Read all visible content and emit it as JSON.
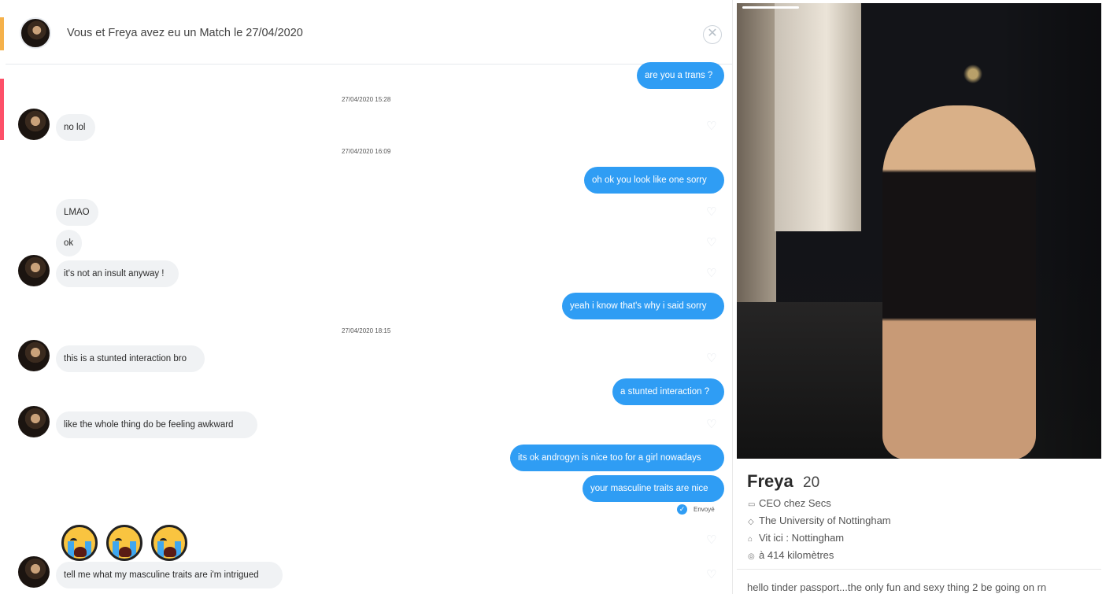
{
  "header": {
    "title": "Vous et Freya avez eu un Match le 27/04/2020"
  },
  "messages": [
    {
      "dir": "out",
      "text": "are you a trans ?"
    },
    {
      "ts": "27/04/2020 15:28"
    },
    {
      "dir": "in",
      "text": "no lol"
    },
    {
      "ts": "27/04/2020 16:09"
    },
    {
      "dir": "out",
      "text": "oh ok you look like one sorry"
    },
    {
      "dir": "in",
      "text": "LMAO"
    },
    {
      "dir": "in",
      "text": "ok"
    },
    {
      "dir": "in",
      "text": "it's not an insult anyway !"
    },
    {
      "dir": "out",
      "text": "yeah i know that's why i said sorry"
    },
    {
      "ts": "27/04/2020 18:15"
    },
    {
      "dir": "in",
      "text": "this is a stunted interaction bro"
    },
    {
      "dir": "out",
      "text": "a stunted interaction ?"
    },
    {
      "dir": "in",
      "text": "like the whole thing do be feeling awkward"
    },
    {
      "dir": "out",
      "text": "its ok androgyn is nice too for a girl nowadays"
    },
    {
      "dir": "out",
      "text": "your masculine traits are nice"
    },
    {
      "dir": "in",
      "emoji": "loudly-crying-face x3"
    },
    {
      "dir": "in",
      "text": "tell me what my masculine traits are i'm intrigued"
    }
  ],
  "sent_status": "Envoyé",
  "profile": {
    "name": "Freya",
    "age": "20",
    "job": "CEO chez Secs",
    "school": "The University of Nottingham",
    "lives": "Vit ici : Nottingham",
    "distance": "à 414 kilomètres",
    "bio": "hello tinder passport...the only fun and sexy thing 2 be going on rn",
    "icons": {
      "job": "briefcase-icon",
      "school": "graduation-cap-icon",
      "lives": "home-icon",
      "distance": "location-pin-icon"
    }
  },
  "colors": {
    "outgoing": "#2f9df4",
    "incoming": "#f0f2f4",
    "accent_red": "#fd5068",
    "accent_yellow": "#f5b14a"
  }
}
